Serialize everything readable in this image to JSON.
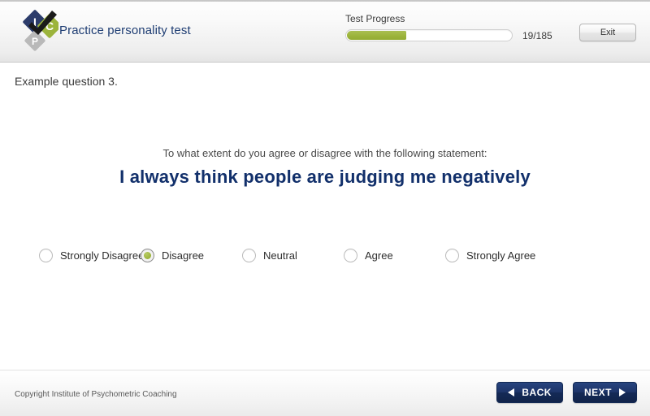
{
  "header": {
    "logo": {
      "icon": "ipc-diamond-check-logo",
      "letters": [
        "I",
        "P",
        "C"
      ],
      "colors": {
        "blue": "#2c3c6b",
        "grey": "#b9b9b9",
        "green": "#9cb43c",
        "check": "#1a1a1a"
      }
    },
    "title": "Practice personality test",
    "title_color": "#1d3c72",
    "progress": {
      "label": "Test Progress",
      "count_text": "19/185",
      "current": 19,
      "total": 185,
      "percent": 37,
      "fill_color": "#9cb43c"
    },
    "exit_button": {
      "label": "Exit",
      "icon": "exit-button"
    }
  },
  "main": {
    "question_index": "Example question 3.",
    "prompt": "To what extent do you agree or disagree with the following statement:",
    "statement": "I always think people are judging me negatively",
    "statement_color": "#12306b",
    "options": [
      {
        "label": "Strongly Disagree",
        "selected": false
      },
      {
        "label": "Disagree",
        "selected": true
      },
      {
        "label": "Neutral",
        "selected": false
      },
      {
        "label": "Agree",
        "selected": false
      },
      {
        "label": "Strongly Agree",
        "selected": false
      }
    ],
    "selected_option": "Disagree"
  },
  "footer": {
    "copyright": "Copyright Institute of Psychometric Coaching",
    "back_button": {
      "label": "BACK",
      "icon": "arrow-left-icon"
    },
    "next_button": {
      "label": "NEXT",
      "icon": "arrow-right-icon"
    },
    "button_color": "#1d3468"
  }
}
